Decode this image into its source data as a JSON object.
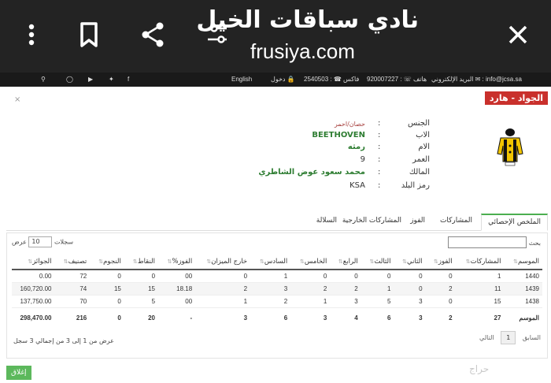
{
  "browser": {
    "title": "نادي سباقات الخيل",
    "url": "frusiya.com",
    "icons": [
      "more-vert-icon",
      "bookmark-icon",
      "share-icon",
      "tune-icon",
      "close-icon"
    ]
  },
  "contact": {
    "email": "البريد الإلكتروني ✉ : info@jcsa.sa",
    "phone": "هاتف ☏ : 920007227",
    "fax": "فاكس ☎ : 2540503",
    "login": "دخول 🔒",
    "lang": "English"
  },
  "modal": {
    "badge": "الجواد - هارد",
    "close": "×"
  },
  "horse": {
    "labels": {
      "sex": "الجنس",
      "sire": "الاب",
      "dam": "الام",
      "age": "العمر",
      "owner": "المالك",
      "country": "رمز البلد"
    },
    "colon": ":",
    "sex": "حصان/احمر",
    "sire": "BEETHOVEN",
    "dam": "رمثه",
    "age": "9",
    "owner": "محمد سعود عوض الشاطري",
    "country": "KSA"
  },
  "tabs": [
    "الملخص الإحصائي",
    "المشاركات",
    "الفوز",
    "المشاركات الخارجية",
    "السلالة"
  ],
  "table_controls": {
    "search_label": "بحث",
    "show_prefix": "عرض",
    "show_value": "10",
    "show_suffix": "سجلات",
    "info": "عرض من 1 إلى 3 من إجمالي 3 سجل",
    "prev": "السابق",
    "page": "1",
    "next": "التالي"
  },
  "table": {
    "headers": [
      "الموسم",
      "المشاركات",
      "الفوز",
      "الثاني",
      "الثالث",
      "الرابع",
      "الخامس",
      "السادس",
      "خارج الميزان",
      "الفوز%",
      "النقاط",
      "النجوم",
      "تصنيف",
      "الجوائز"
    ],
    "rows": [
      [
        "1440",
        "1",
        "0",
        "0",
        "0",
        "0",
        "0",
        "1",
        "0",
        "00",
        "0",
        "0",
        "72",
        "0.00"
      ],
      [
        "1439",
        "11",
        "2",
        "0",
        "1",
        "2",
        "2",
        "3",
        "2",
        "18.18",
        "15",
        "15",
        "74",
        "160,720.00"
      ],
      [
        "1438",
        "15",
        "0",
        "3",
        "5",
        "3",
        "1",
        "2",
        "1",
        "00",
        "5",
        "0",
        "70",
        "137,750.00"
      ]
    ],
    "totals": [
      "الموسم",
      "27",
      "2",
      "3",
      "6",
      "4",
      "3",
      "6",
      "3",
      "-",
      "20",
      "0",
      "216",
      "298,470.00"
    ]
  },
  "footer": {
    "back": "إغلاق",
    "watermark": "حراج"
  },
  "colors": {
    "badge": "#c9302c",
    "active_tab": "#4caf50",
    "back_button": "#5cb85c",
    "topbar": "#232323"
  }
}
